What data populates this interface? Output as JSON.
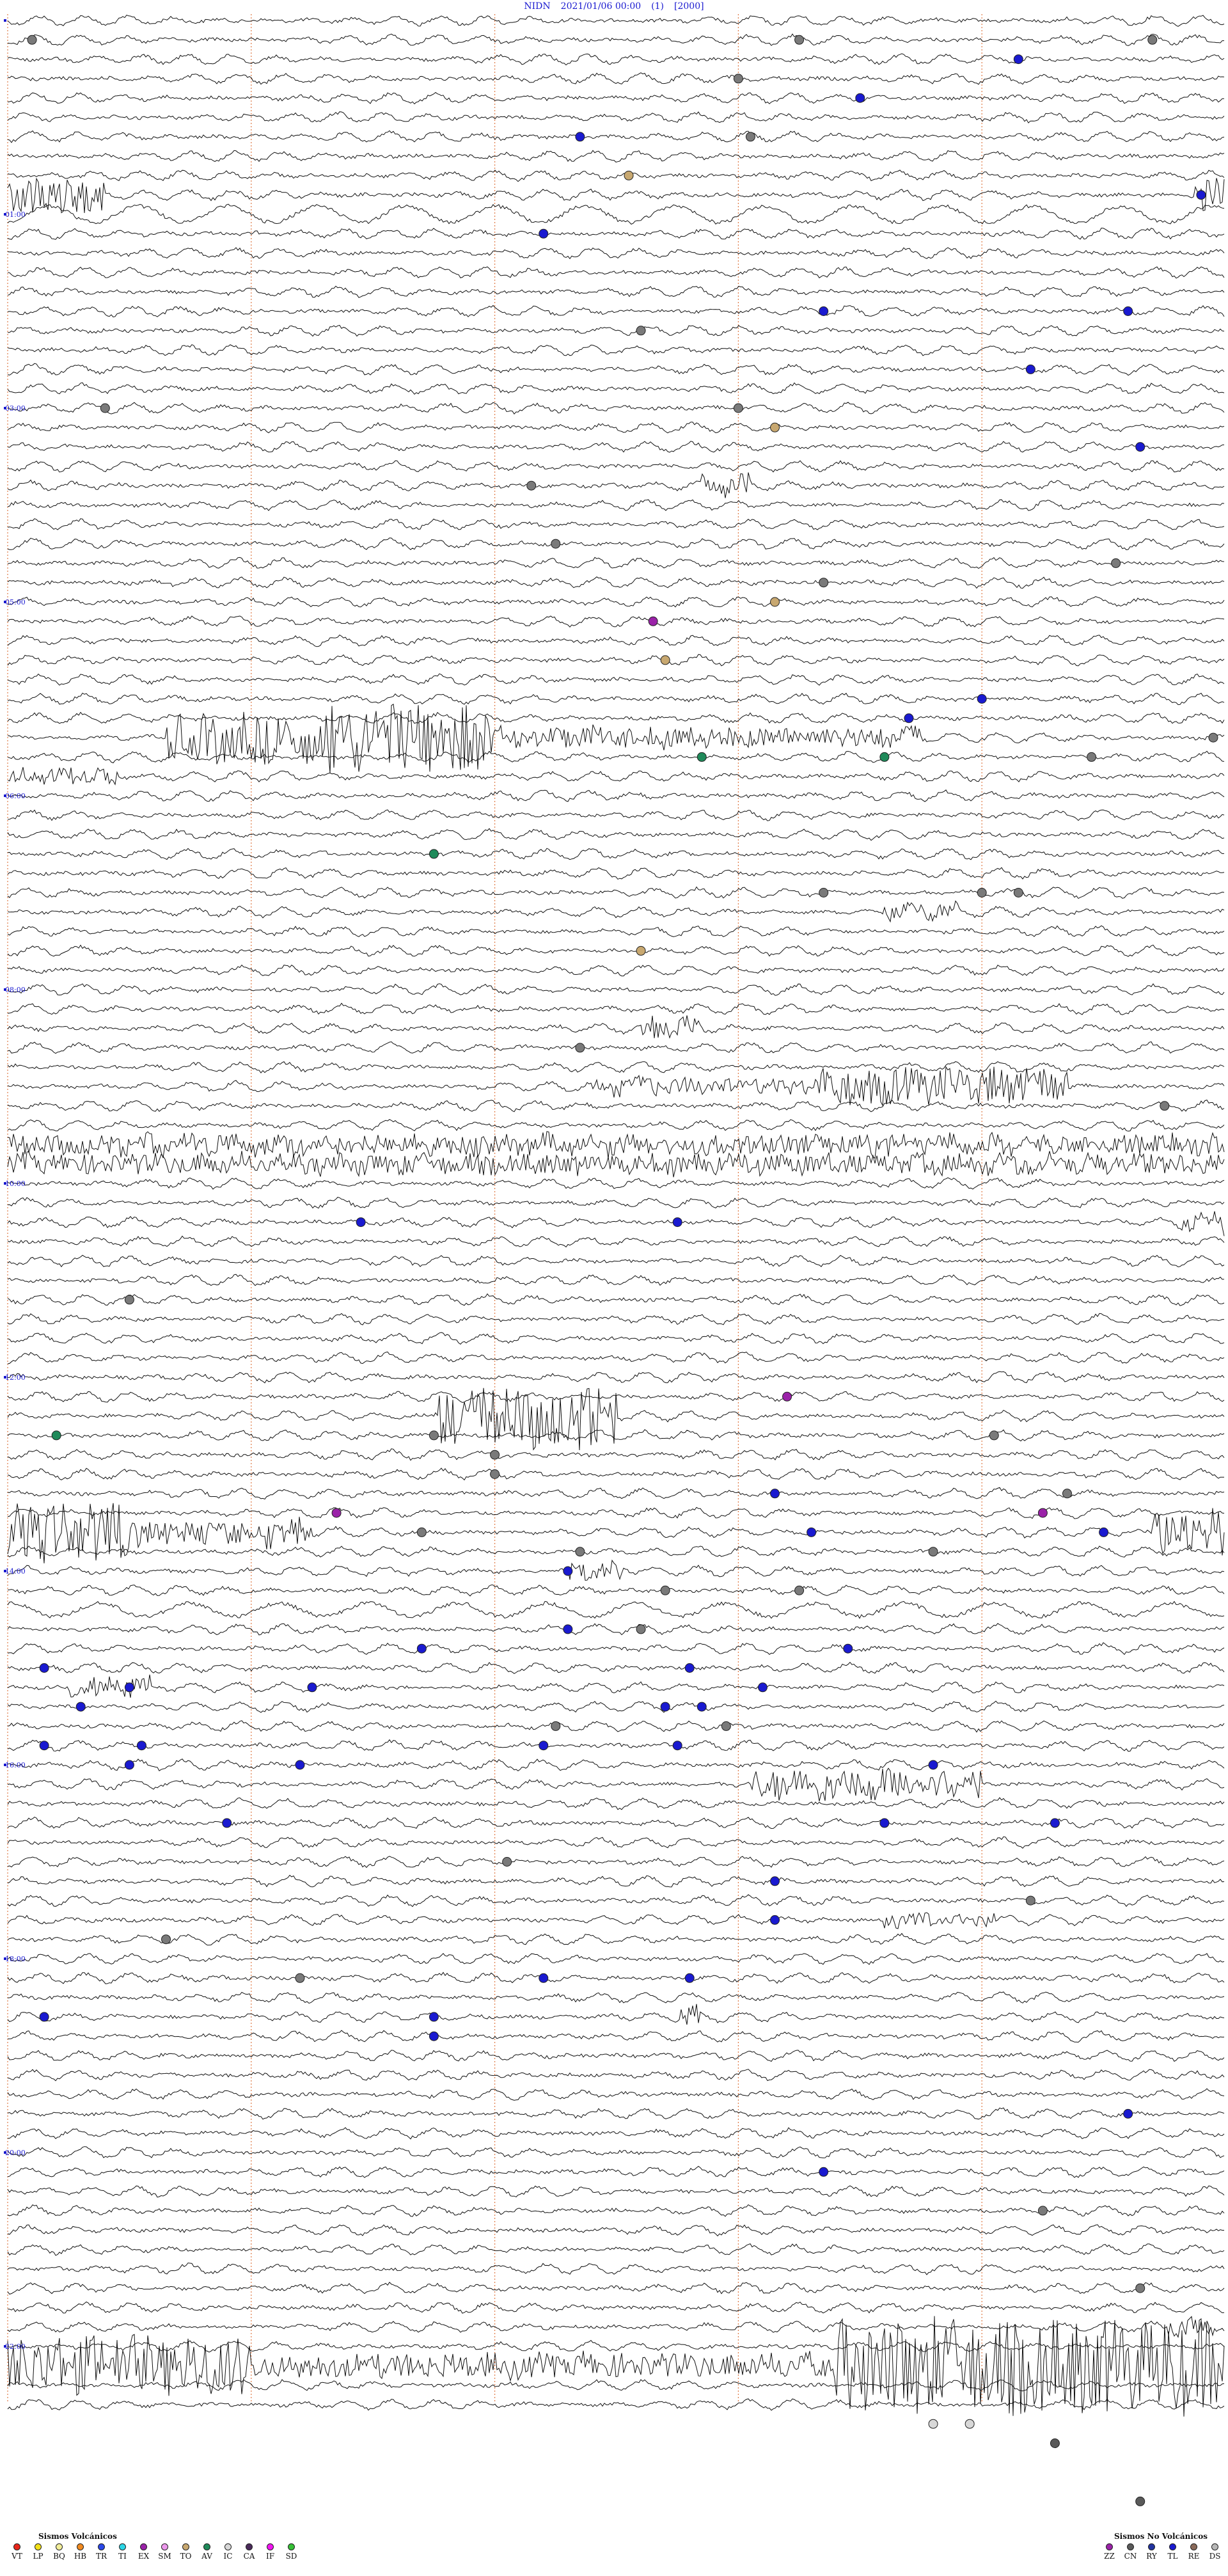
{
  "header": {
    "station": "NIDN",
    "datetime": "2021/01/06 00:00",
    "gain": "(1)",
    "scale": "[2000]"
  },
  "chart_data": {
    "type": "seismogram",
    "line_count": 124,
    "hour_labels": [
      {
        "line": 0,
        "text": ""
      },
      {
        "line": 10,
        "text": "01:00"
      },
      {
        "line": 20,
        "text": "03:00"
      },
      {
        "line": 30,
        "text": "05:00"
      },
      {
        "line": 40,
        "text": "06:00"
      },
      {
        "line": 50,
        "text": "08:00"
      },
      {
        "line": 60,
        "text": "10:00"
      },
      {
        "line": 70,
        "text": "12:00"
      },
      {
        "line": 80,
        "text": "14:00"
      },
      {
        "line": 90,
        "text": "16:00"
      },
      {
        "line": 100,
        "text": "18:00"
      },
      {
        "line": 110,
        "text": "20:00"
      },
      {
        "line": 120,
        "text": "22:00"
      }
    ],
    "bursts": [
      {
        "line": 9,
        "start": 0.0,
        "end": 0.08,
        "amp": 2.0
      },
      {
        "line": 9,
        "start": 0.975,
        "end": 1.0,
        "amp": 2.0
      },
      {
        "line": 10,
        "start": 0.0,
        "end": 1.0,
        "amp": 1.6,
        "type": "wave"
      },
      {
        "line": 24,
        "start": 0.57,
        "end": 0.61,
        "amp": 1.0
      },
      {
        "line": 37,
        "start": 0.13,
        "end": 0.27,
        "amp": 2.5
      },
      {
        "line": 37,
        "start": 0.26,
        "end": 0.4,
        "amp": 3.6
      },
      {
        "line": 37,
        "start": 0.4,
        "end": 0.75,
        "amp": 1.0
      },
      {
        "line": 39,
        "start": 0.0,
        "end": 0.09,
        "amp": 0.8
      },
      {
        "line": 46,
        "start": 0.72,
        "end": 0.78,
        "amp": 0.8
      },
      {
        "line": 52,
        "start": 0.52,
        "end": 0.57,
        "amp": 1.2
      },
      {
        "line": 55,
        "start": 0.48,
        "end": 0.66,
        "amp": 0.8
      },
      {
        "line": 55,
        "start": 0.66,
        "end": 0.87,
        "amp": 1.9
      },
      {
        "line": 58,
        "start": 0.0,
        "end": 1.0,
        "amp": 1.0
      },
      {
        "line": 59,
        "start": 0.0,
        "end": 1.0,
        "amp": 1.0
      },
      {
        "line": 62,
        "start": 0.96,
        "end": 1.0,
        "amp": 1.0
      },
      {
        "line": 72,
        "start": 0.35,
        "end": 0.43,
        "amp": 3.0
      },
      {
        "line": 72,
        "start": 0.43,
        "end": 0.5,
        "amp": 3.4
      },
      {
        "line": 78,
        "start": 0.0,
        "end": 0.1,
        "amp": 3.0
      },
      {
        "line": 78,
        "start": 0.1,
        "end": 0.25,
        "amp": 1.4
      },
      {
        "line": 78,
        "start": 0.94,
        "end": 1.0,
        "amp": 2.5
      },
      {
        "line": 80,
        "start": 0.46,
        "end": 0.51,
        "amp": 0.9
      },
      {
        "line": 82,
        "start": 0.0,
        "end": 1.0,
        "amp": 1.3,
        "type": "wave"
      },
      {
        "line": 86,
        "start": 0.05,
        "end": 0.12,
        "amp": 1.1
      },
      {
        "line": 91,
        "start": 0.61,
        "end": 0.8,
        "amp": 1.6
      },
      {
        "line": 98,
        "start": 0.72,
        "end": 0.81,
        "amp": 0.8
      },
      {
        "line": 103,
        "start": 0.55,
        "end": 0.57,
        "amp": 1.0
      },
      {
        "line": 119,
        "start": 0.95,
        "end": 0.99,
        "amp": 0.9
      },
      {
        "line": 121,
        "start": 0.0,
        "end": 0.2,
        "amp": 3.0
      },
      {
        "line": 121,
        "start": 0.2,
        "end": 0.68,
        "amp": 1.2
      },
      {
        "line": 121,
        "start": 0.68,
        "end": 1.0,
        "amp": 5.0
      }
    ],
    "events": [
      {
        "line": 1,
        "x": 0.02,
        "type": "IC"
      },
      {
        "line": 1,
        "x": 0.65,
        "type": "IC"
      },
      {
        "line": 1,
        "x": 0.94,
        "type": "IC"
      },
      {
        "line": 2,
        "x": 0.83,
        "type": "HB"
      },
      {
        "line": 3,
        "x": 0.6,
        "type": "IC"
      },
      {
        "line": 4,
        "x": 0.7,
        "type": "HB"
      },
      {
        "line": 6,
        "x": 0.47,
        "type": "HB"
      },
      {
        "line": 6,
        "x": 0.61,
        "type": "IC"
      },
      {
        "line": 8,
        "x": 0.51,
        "type": "SM"
      },
      {
        "line": 9,
        "x": 0.98,
        "type": "HB"
      },
      {
        "line": 11,
        "x": 0.44,
        "type": "HB"
      },
      {
        "line": 15,
        "x": 0.67,
        "type": "HB"
      },
      {
        "line": 15,
        "x": 0.92,
        "type": "HB"
      },
      {
        "line": 16,
        "x": 0.52,
        "type": "IC"
      },
      {
        "line": 18,
        "x": 0.84,
        "type": "HB"
      },
      {
        "line": 20,
        "x": 0.08,
        "type": "IC"
      },
      {
        "line": 20,
        "x": 0.6,
        "type": "IC"
      },
      {
        "line": 21,
        "x": 0.63,
        "type": "SM"
      },
      {
        "line": 22,
        "x": 0.93,
        "type": "HB"
      },
      {
        "line": 24,
        "x": 0.43,
        "type": "IC"
      },
      {
        "line": 27,
        "x": 0.45,
        "type": "IC"
      },
      {
        "line": 28,
        "x": 0.91,
        "type": "IC"
      },
      {
        "line": 29,
        "x": 0.67,
        "type": "IC"
      },
      {
        "line": 30,
        "x": 0.63,
        "type": "SM"
      },
      {
        "line": 31,
        "x": 0.53,
        "type": "EX"
      },
      {
        "line": 33,
        "x": 0.54,
        "type": "SM"
      },
      {
        "line": 35,
        "x": 0.8,
        "type": "HB"
      },
      {
        "line": 36,
        "x": 0.74,
        "type": "HB"
      },
      {
        "line": 37,
        "x": 0.99,
        "type": "IC"
      },
      {
        "line": 38,
        "x": 0.57,
        "type": "AV"
      },
      {
        "line": 38,
        "x": 0.72,
        "type": "AV"
      },
      {
        "line": 38,
        "x": 0.89,
        "type": "IC"
      },
      {
        "line": 43,
        "x": 0.35,
        "type": "AV"
      },
      {
        "line": 45,
        "x": 0.67,
        "type": "IC"
      },
      {
        "line": 45,
        "x": 0.8,
        "type": "IC"
      },
      {
        "line": 45,
        "x": 0.83,
        "type": "IC"
      },
      {
        "line": 48,
        "x": 0.52,
        "type": "SM"
      },
      {
        "line": 53,
        "x": 0.47,
        "type": "IC"
      },
      {
        "line": 56,
        "x": 0.95,
        "type": "IC"
      },
      {
        "line": 62,
        "x": 0.29,
        "type": "HB"
      },
      {
        "line": 62,
        "x": 0.55,
        "type": "HB"
      },
      {
        "line": 66,
        "x": 0.1,
        "type": "IC"
      },
      {
        "line": 71,
        "x": 0.64,
        "type": "EX"
      },
      {
        "line": 73,
        "x": 0.35,
        "type": "IC"
      },
      {
        "line": 73,
        "x": 0.81,
        "type": "IC"
      },
      {
        "line": 73,
        "x": 0.04,
        "type": "AV"
      },
      {
        "line": 74,
        "x": 0.4,
        "type": "IC"
      },
      {
        "line": 75,
        "x": 0.4,
        "type": "IC"
      },
      {
        "line": 76,
        "x": 0.63,
        "type": "HB"
      },
      {
        "line": 76,
        "x": 0.87,
        "type": "IC"
      },
      {
        "line": 77,
        "x": 0.27,
        "type": "EX"
      },
      {
        "line": 77,
        "x": 0.85,
        "type": "EX"
      },
      {
        "line": 78,
        "x": 0.34,
        "type": "IC"
      },
      {
        "line": 78,
        "x": 0.66,
        "type": "HB"
      },
      {
        "line": 78,
        "x": 0.9,
        "type": "HB"
      },
      {
        "line": 79,
        "x": 0.47,
        "type": "IC"
      },
      {
        "line": 79,
        "x": 0.76,
        "type": "IC"
      },
      {
        "line": 80,
        "x": 0.46,
        "type": "HB"
      },
      {
        "line": 81,
        "x": 0.54,
        "type": "IC"
      },
      {
        "line": 81,
        "x": 0.65,
        "type": "IC"
      },
      {
        "line": 83,
        "x": 0.46,
        "type": "HB"
      },
      {
        "line": 83,
        "x": 0.52,
        "type": "IC"
      },
      {
        "line": 84,
        "x": 0.34,
        "type": "HB"
      },
      {
        "line": 84,
        "x": 0.69,
        "type": "HB"
      },
      {
        "line": 85,
        "x": 0.03,
        "type": "HB"
      },
      {
        "line": 85,
        "x": 0.56,
        "type": "HB"
      },
      {
        "line": 86,
        "x": 0.1,
        "type": "HB"
      },
      {
        "line": 86,
        "x": 0.25,
        "type": "HB"
      },
      {
        "line": 86,
        "x": 0.62,
        "type": "HB"
      },
      {
        "line": 87,
        "x": 0.06,
        "type": "HB"
      },
      {
        "line": 87,
        "x": 0.54,
        "type": "HB"
      },
      {
        "line": 87,
        "x": 0.57,
        "type": "HB"
      },
      {
        "line": 88,
        "x": 0.45,
        "type": "IC"
      },
      {
        "line": 88,
        "x": 0.59,
        "type": "IC"
      },
      {
        "line": 89,
        "x": 0.03,
        "type": "HB"
      },
      {
        "line": 89,
        "x": 0.11,
        "type": "HB"
      },
      {
        "line": 89,
        "x": 0.44,
        "type": "HB"
      },
      {
        "line": 89,
        "x": 0.55,
        "type": "HB"
      },
      {
        "line": 90,
        "x": 0.1,
        "type": "HB"
      },
      {
        "line": 90,
        "x": 0.24,
        "type": "HB"
      },
      {
        "line": 90,
        "x": 0.76,
        "type": "HB"
      },
      {
        "line": 93,
        "x": 0.18,
        "type": "HB"
      },
      {
        "line": 93,
        "x": 0.72,
        "type": "HB"
      },
      {
        "line": 93,
        "x": 0.86,
        "type": "HB"
      },
      {
        "line": 95,
        "x": 0.41,
        "type": "IC"
      },
      {
        "line": 96,
        "x": 0.63,
        "type": "HB"
      },
      {
        "line": 97,
        "x": 0.84,
        "type": "IC"
      },
      {
        "line": 98,
        "x": 0.63,
        "type": "HB"
      },
      {
        "line": 99,
        "x": 0.13,
        "type": "IC"
      },
      {
        "line": 101,
        "x": 0.24,
        "type": "IC"
      },
      {
        "line": 101,
        "x": 0.44,
        "type": "HB"
      },
      {
        "line": 101,
        "x": 0.56,
        "type": "HB"
      },
      {
        "line": 103,
        "x": 0.03,
        "type": "HB"
      },
      {
        "line": 103,
        "x": 0.35,
        "type": "HB"
      },
      {
        "line": 104,
        "x": 0.35,
        "type": "HB"
      },
      {
        "line": 108,
        "x": 0.92,
        "type": "HB"
      },
      {
        "line": 111,
        "x": 0.67,
        "type": "HB"
      },
      {
        "line": 113,
        "x": 0.85,
        "type": "IC"
      },
      {
        "line": 117,
        "x": 0.93,
        "type": "IC"
      },
      {
        "line": 124,
        "x": 0.76,
        "type": "IC"
      },
      {
        "line": 124,
        "x": 0.79,
        "type": "IC"
      },
      {
        "line": 125,
        "x": 0.86,
        "type": "CA"
      },
      {
        "line": 128,
        "x": 0.93,
        "type": "CA"
      }
    ]
  },
  "legend": {
    "volcanic": {
      "title": "Sismos Volcánicos",
      "items": [
        {
          "code": "VT",
          "color": "#e8261a"
        },
        {
          "code": "LP",
          "color": "#f2e018"
        },
        {
          "code": "BQ",
          "color": "#f2ee9a"
        },
        {
          "code": "HB",
          "color": "#f08a20"
        },
        {
          "code": "TR",
          "color": "#2a48e8"
        },
        {
          "code": "TI",
          "color": "#2cd6e6"
        },
        {
          "code": "EX",
          "color": "#9a22a8"
        },
        {
          "code": "SM",
          "color": "#ec98ec"
        },
        {
          "code": "TO",
          "color": "#c8a870"
        },
        {
          "code": "AV",
          "color": "#1f8a5a"
        },
        {
          "code": "IC",
          "color": "#d8d8d8"
        },
        {
          "code": "CA",
          "color": "#4a2a5a"
        },
        {
          "code": "IF",
          "color": "#f214f2"
        },
        {
          "code": "SD",
          "color": "#36c036"
        }
      ]
    },
    "non_volcanic": {
      "title": "Sismos No Volcánicos",
      "items": [
        {
          "code": "ZZ",
          "color": "#9a22a8"
        },
        {
          "code": "CN",
          "color": "#5a5a5a"
        },
        {
          "code": "RY",
          "color": "#2233a0"
        },
        {
          "code": "TL",
          "color": "#1a1ad0"
        },
        {
          "code": "RE",
          "color": "#8a6a5a"
        },
        {
          "code": "DS",
          "color": "#b8b8b8"
        }
      ]
    }
  }
}
